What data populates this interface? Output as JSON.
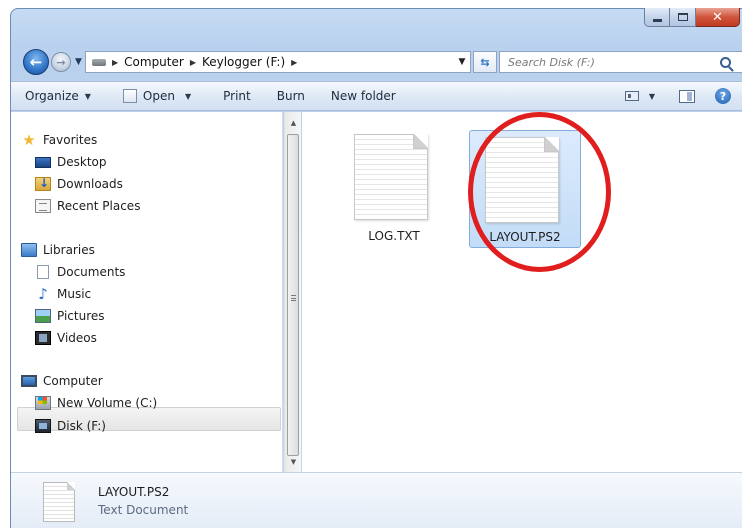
{
  "address": {
    "crumbs": [
      "Computer",
      "Keylogger (F:)"
    ]
  },
  "search": {
    "placeholder": "Search Disk (F:)"
  },
  "toolbar": {
    "organize": "Organize",
    "open": "Open",
    "print": "Print",
    "burn": "Burn",
    "new_folder": "New folder"
  },
  "nav": {
    "favorites": "Favorites",
    "desktop": "Desktop",
    "downloads": "Downloads",
    "recent_places": "Recent Places",
    "libraries": "Libraries",
    "documents": "Documents",
    "music": "Music",
    "pictures": "Pictures",
    "videos": "Videos",
    "computer": "Computer",
    "new_volume": "New Volume (C:)",
    "disk": "Disk (F:)"
  },
  "files": [
    {
      "name": "LOG.TXT"
    },
    {
      "name": "LAYOUT.PS2"
    }
  ],
  "details": {
    "name": "LAYOUT.PS2",
    "type": "Text Document"
  },
  "colors": {
    "highlight_circle": "#e01e1e",
    "selection": "#c3dcf7"
  }
}
